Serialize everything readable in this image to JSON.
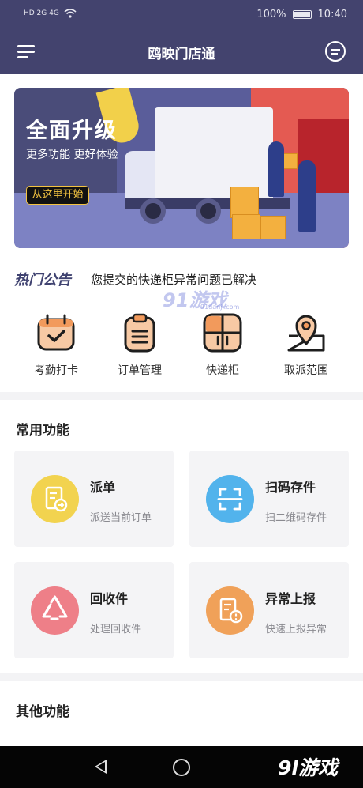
{
  "status_bar": {
    "left": "HD 2G 4G",
    "battery": "100%",
    "time": "10:40"
  },
  "header": {
    "title": "鸥映门店通",
    "menu_icon": "hamburger-menu-icon",
    "message_icon": "message-bubble-icon"
  },
  "banner": {
    "title": "全面升级",
    "subtitle": "更多功能 更好体验",
    "button": "从这里开始",
    "colors": {
      "bg": "#4a4c79",
      "accent": "#f3c341"
    }
  },
  "notice": {
    "tag": "热门公告",
    "text": "您提交的快递柜异常问题已解决"
  },
  "watermark": {
    "text": "91游戏",
    "domain": "91danji.com"
  },
  "quick_actions": [
    {
      "label": "考勤打卡",
      "icon": "calendar-check-icon"
    },
    {
      "label": "订单管理",
      "icon": "clipboard-list-icon"
    },
    {
      "label": "快递柜",
      "icon": "locker-icon"
    },
    {
      "label": "取派范围",
      "icon": "map-pin-icon"
    }
  ],
  "common": {
    "title": "常用功能",
    "cards": [
      {
        "title": "派单",
        "sub": "派送当前订单",
        "icon": "dispatch-doc-icon",
        "color": "#f2d34f"
      },
      {
        "title": "扫码存件",
        "sub": "扫二维码存件",
        "icon": "scan-frame-icon",
        "color": "#52b3ec"
      },
      {
        "title": "回收件",
        "sub": "处理回收件",
        "icon": "recycle-icon",
        "color": "#ee7f88"
      },
      {
        "title": "异常上报",
        "sub": "快速上报异常",
        "icon": "exception-report-icon",
        "color": "#f0a159"
      }
    ]
  },
  "other": {
    "title": "其他功能"
  },
  "system_nav": {
    "logo": "9l游戏"
  }
}
